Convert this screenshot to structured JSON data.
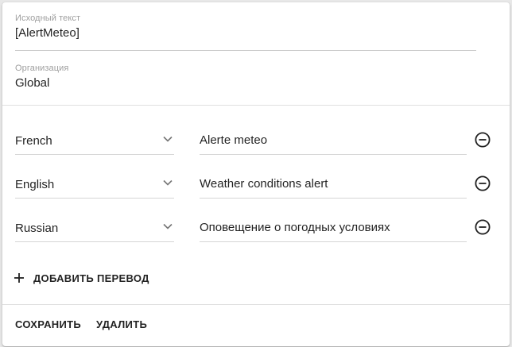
{
  "source": {
    "label": "Исходный текст",
    "value": "[AlertMeteo]"
  },
  "organization": {
    "label": "Организация",
    "value": "Global"
  },
  "translations": [
    {
      "language": "French",
      "text": "Alerte meteo"
    },
    {
      "language": "English",
      "text": "Weather conditions alert"
    },
    {
      "language": "Russian",
      "text": "Оповещение о погодных условиях"
    }
  ],
  "add_translation_label": "ДОБАВИТЬ ПЕРЕВОД",
  "actions": {
    "save_label": "СОХРАНИТЬ",
    "delete_label": "УДАЛИТЬ"
  },
  "icons": {
    "expand": "chevron-down-icon",
    "remove": "remove-circle-icon",
    "add": "plus-icon"
  },
  "colors": {
    "background": "#ffffff",
    "underline": "#d5d5d5",
    "label": "#9e9e9e",
    "text": "#212121"
  }
}
